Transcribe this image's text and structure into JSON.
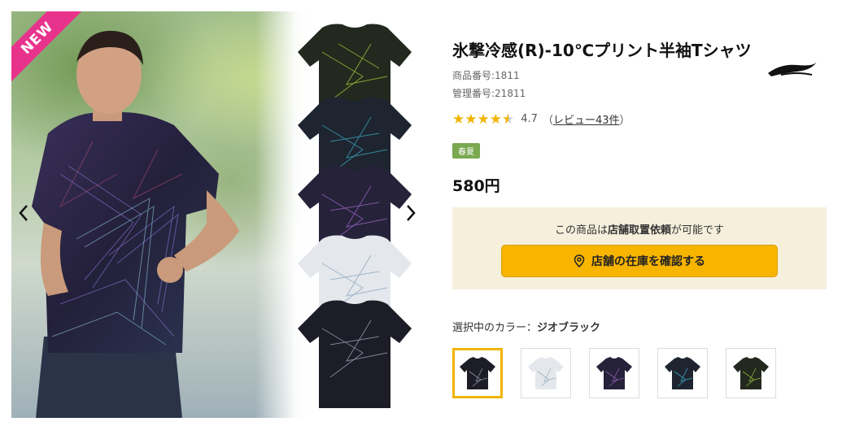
{
  "gallery": {
    "badge": "NEW",
    "prev_symbol": "‹",
    "next_symbol": "›",
    "shirt_stack": [
      "green-black",
      "blue-black",
      "purple-black",
      "white",
      "black"
    ]
  },
  "product": {
    "title": "氷撃冷感(R)-10℃プリント半袖Tシャツ",
    "product_number": "商品番号:1811",
    "management_number": "管理番号:21811",
    "rating_value": "4.7",
    "review_text": "レビュー43件",
    "review_prefix": "（",
    "review_suffix": "）",
    "season_badge": "春夏",
    "price": "580円",
    "star_count": 5
  },
  "store": {
    "text_prefix": "この商品は",
    "text_bold": "店舗取置依頼",
    "text_suffix": "が可能です",
    "button_label": "店舗の在庫を確認する"
  },
  "color_selection": {
    "label": "選択中のカラー：",
    "selected_name": "ジオブラック",
    "swatches": [
      {
        "name": "black",
        "body": "#1d1d28",
        "accent": "#8d8da0"
      },
      {
        "name": "white",
        "body": "#e4e8ec",
        "accent": "#9fb0c4"
      },
      {
        "name": "purple",
        "body": "#25223a",
        "accent": "#8a5cb0"
      },
      {
        "name": "blue",
        "body": "#1e2530",
        "accent": "#3aa0b8"
      },
      {
        "name": "green",
        "body": "#23291e",
        "accent": "#8fb23a"
      }
    ]
  },
  "colors": {
    "accent_yellow": "#f7b500",
    "badge_pink": "#e8338c",
    "season_green": "#7aa850",
    "store_bg": "#f6efdc"
  }
}
